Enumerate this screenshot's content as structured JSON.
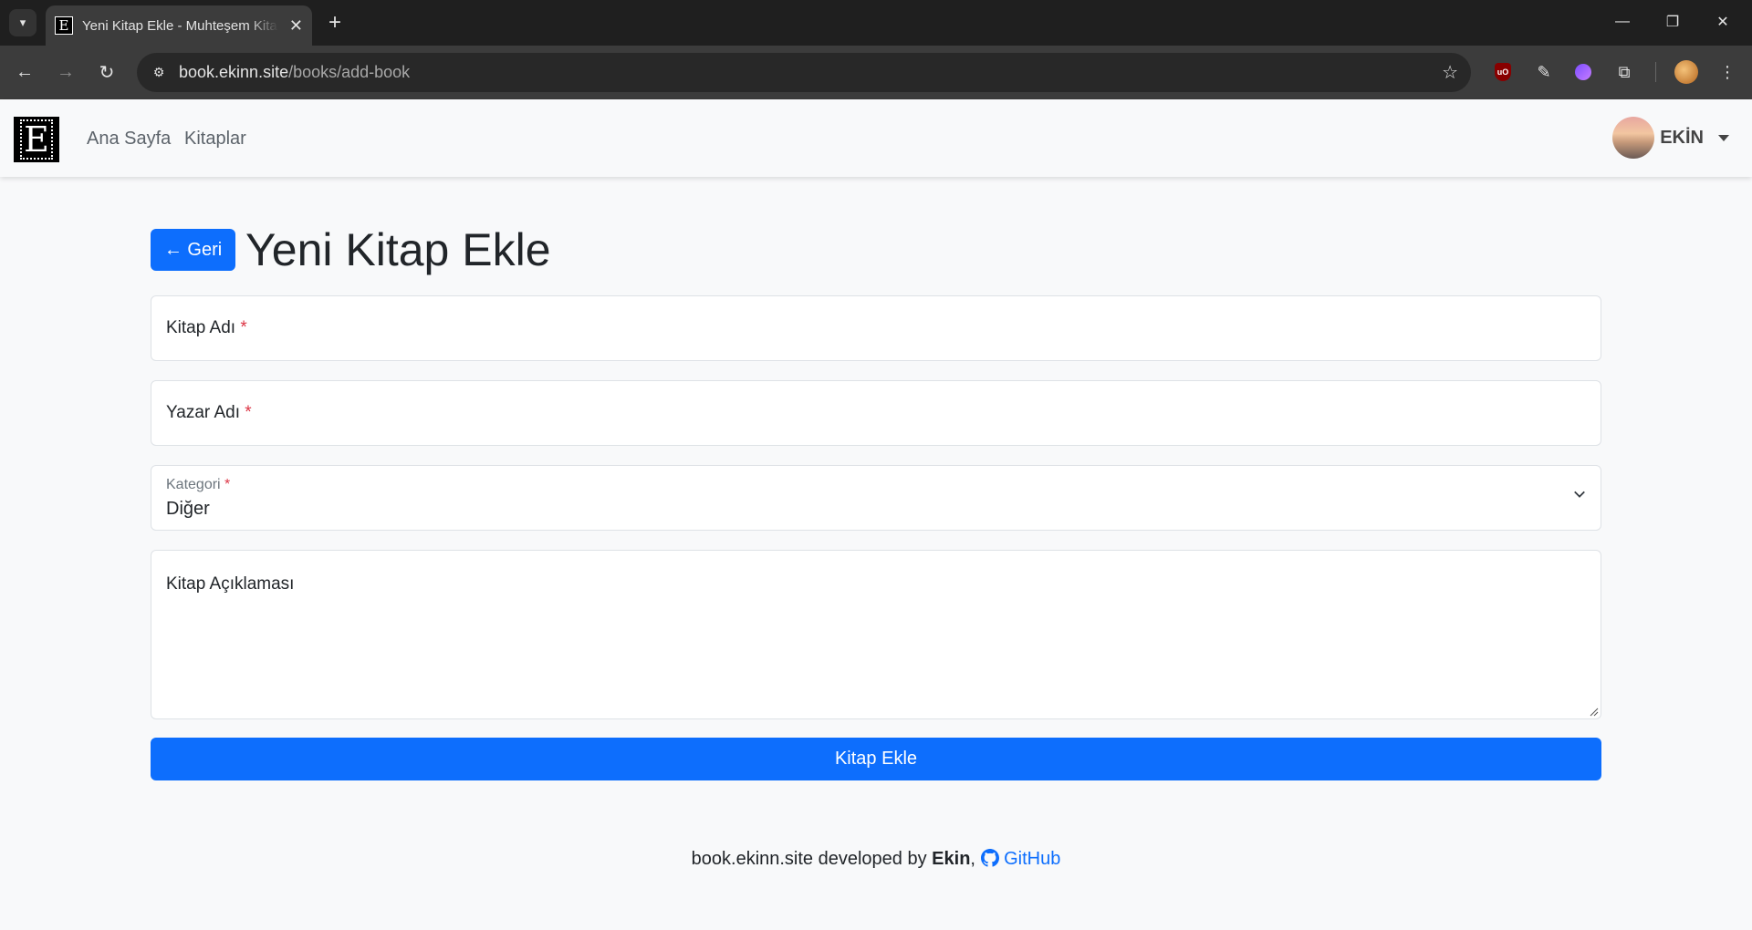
{
  "browser": {
    "tab_title": "Yeni Kitap Ekle - Muhteşem Kitap",
    "tab_favicon": "E",
    "url_host": "book.ekinn.site",
    "url_path": "/books/add-book",
    "extension_ublock_label": "uO"
  },
  "navbar": {
    "logo_letter": "E",
    "links": [
      "Ana Sayfa",
      "Kitaplar"
    ],
    "user_name": "EKİN"
  },
  "page": {
    "back_label": "← Geri",
    "title": "Yeni Kitap Ekle"
  },
  "form": {
    "book_name_label": "Kitap Adı",
    "author_label": "Yazar Adı",
    "category_label": "Kategori",
    "category_value": "Diğer",
    "description_label": "Kitap Açıklaması",
    "required_mark": "*",
    "submit_label": "Kitap Ekle"
  },
  "footer": {
    "site": "book.ekinn.site",
    "developed_by": " developed by ",
    "author": "Ekin",
    "separator": ", ",
    "github_label": "GitHub"
  },
  "colors": {
    "primary": "#0d6efd",
    "required": "#dc3545",
    "chrome_dark": "#1f1f1f"
  }
}
